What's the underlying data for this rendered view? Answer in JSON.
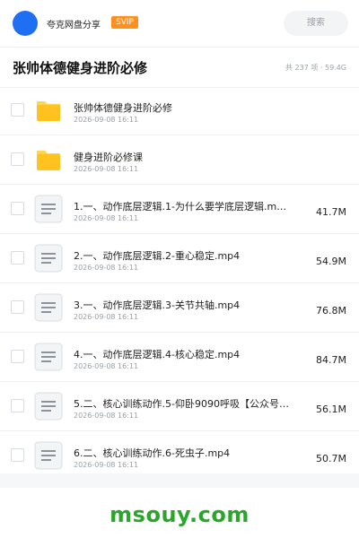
{
  "header": {
    "share_title": "夸克网盘分享",
    "badge": "SVIP",
    "search_label": "搜索"
  },
  "title_bar": {
    "title": "张帅体德健身进阶必修",
    "stats": "共 237 项 · 59.4G"
  },
  "items": [
    {
      "type": "folder",
      "name": "张帅体德健身进阶必修",
      "date": "2026-09-08 16:11",
      "size": ""
    },
    {
      "type": "folder",
      "name": "健身进阶必修课",
      "date": "2026-09-08 16:11",
      "size": ""
    },
    {
      "type": "file",
      "name": "1.一、动作底层逻辑.1-为什么要学底层逻辑.mp4",
      "date": "2026-09-08 16:11",
      "size": "41.7M"
    },
    {
      "type": "file",
      "name": "2.一、动作底层逻辑.2-重心稳定.mp4",
      "date": "2026-09-08 16:11",
      "size": "54.9M"
    },
    {
      "type": "file",
      "name": "3.一、动作底层逻辑.3-关节共轴.mp4",
      "date": "2026-09-08 16:11",
      "size": "76.8M"
    },
    {
      "type": "file",
      "name": "4.一、动作底层逻辑.4-核心稳定.mp4",
      "date": "2026-09-08 16:11",
      "size": "84.7M"
    },
    {
      "type": "file",
      "name": "5.二、核心训练动作.5-仰卧9090呼吸【公众号…",
      "date": "2026-09-08 16:11",
      "size": "56.1M"
    },
    {
      "type": "file",
      "name": "6.二、核心训练动作.6-死虫子.mp4",
      "date": "2026-09-08 16:11",
      "size": "50.7M"
    }
  ],
  "watermark": "msouy.com",
  "colors": {
    "avatar": "#1f6ff5",
    "badge": "#ff8f1f",
    "folder": "#ffc21f",
    "watermark": "#2aa72a"
  }
}
